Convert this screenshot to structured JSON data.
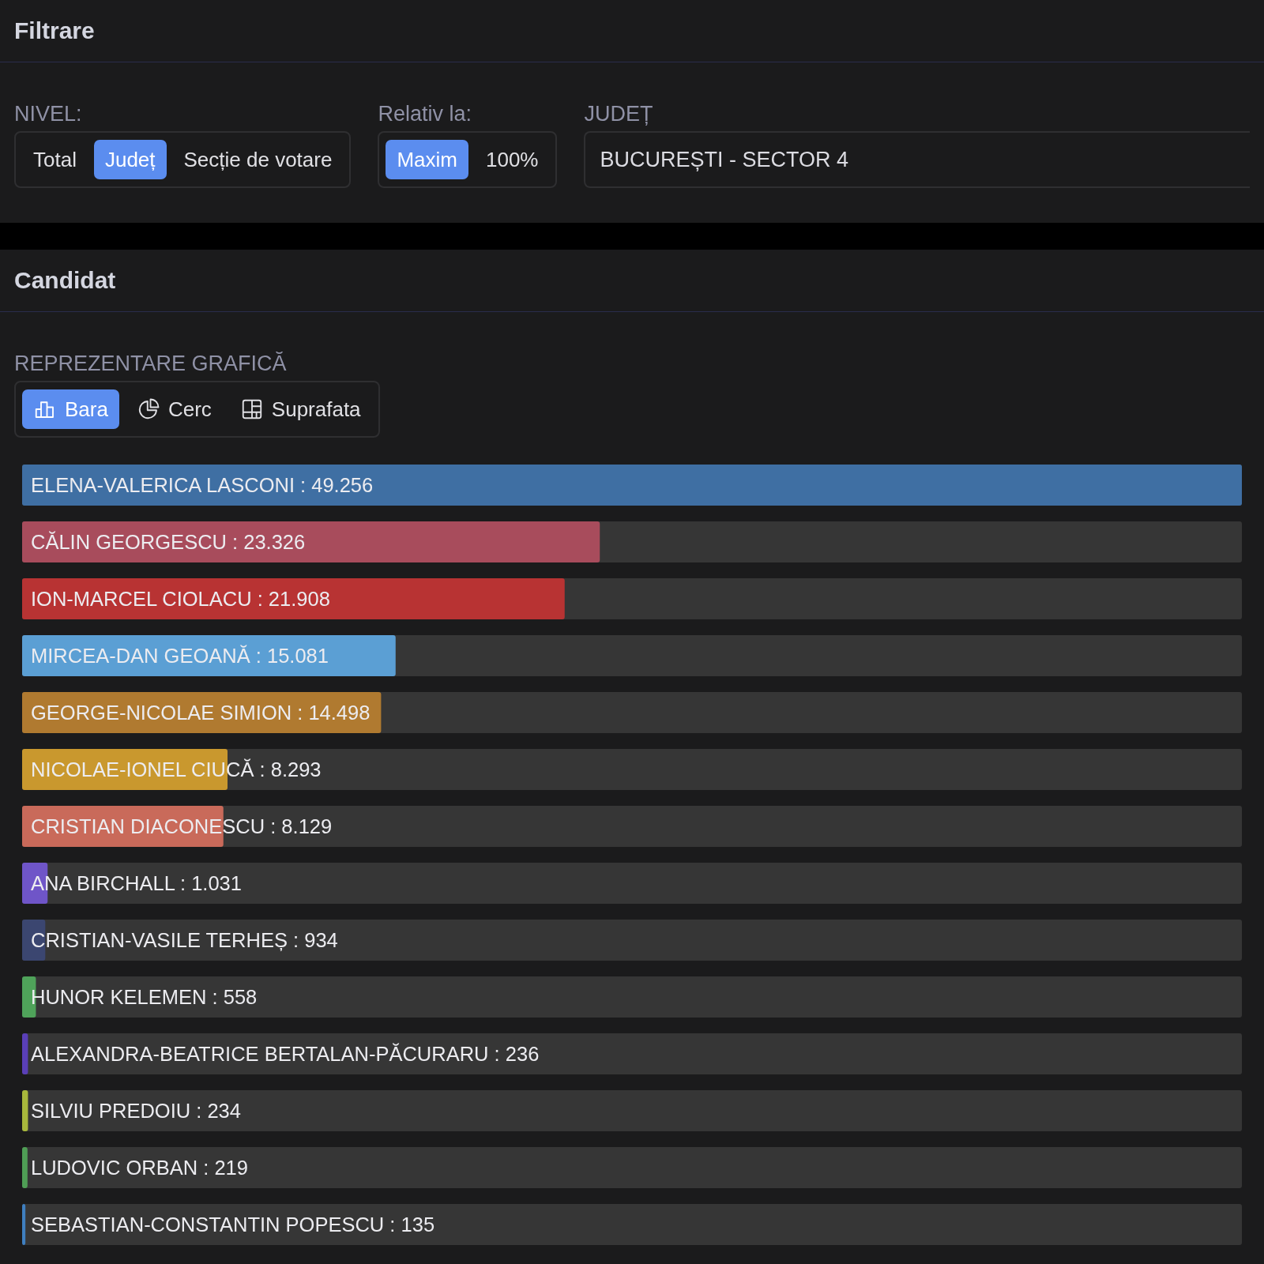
{
  "filtrare": {
    "title": "Filtrare",
    "nivel": {
      "label": "NIVEL:",
      "options": [
        {
          "label": "Total",
          "selected": false
        },
        {
          "label": "Județ",
          "selected": true
        },
        {
          "label": "Secție de votare",
          "selected": false
        }
      ]
    },
    "relativ": {
      "label": "Relativ la:",
      "options": [
        {
          "label": "Maxim",
          "selected": true
        },
        {
          "label": "100%",
          "selected": false
        }
      ]
    },
    "judet": {
      "label": "JUDEȚ",
      "value": "BUCUREȘTI - SECTOR 4"
    }
  },
  "candidat": {
    "title": "Candidat",
    "reprezentare": {
      "label": "REPREZENTARE GRAFICĂ",
      "options": [
        {
          "label": "Bara",
          "kind": "bar",
          "selected": true
        },
        {
          "label": "Cerc",
          "kind": "pie",
          "selected": false
        },
        {
          "label": "Suprafata",
          "kind": "grid",
          "selected": false
        }
      ]
    },
    "results": [
      {
        "label": "ELENA-VALERICA LASCONI : 49.256",
        "color": "#3f6fa3",
        "level": 1
      },
      {
        "label": "CĂLIN GEORGESCU : 23.326",
        "color": "#a84c5c",
        "level": 0.4736
      },
      {
        "label": "ION-MARCEL CIOLACU : 21.908",
        "color": "#b83333",
        "level": 0.4448
      },
      {
        "label": "MIRCEA-DAN GEOANĂ : 15.081",
        "color": "#5b9fd4",
        "level": 0.3062
      },
      {
        "label": "GEORGE-NICOLAE SIMION : 14.498",
        "color": "#b07a30",
        "level": 0.2943
      },
      {
        "label": "NICOLAE-IONEL CIUCĂ : 8.293",
        "color": "#c9982e",
        "level": 0.1684
      },
      {
        "label": "CRISTIAN DIACONESCU : 8.129",
        "color": "#c96a5a",
        "level": 0.165
      },
      {
        "label": "ANA BIRCHALL : 1.031",
        "color": "#6f55c8",
        "level": 0.0209
      },
      {
        "label": "CRISTIAN-VASILE TERHEȘ : 934",
        "color": "#3b4670",
        "level": 0.019
      },
      {
        "label": "HUNOR KELEMEN : 558",
        "color": "#4fa35a",
        "level": 0.0113
      },
      {
        "label": "ALEXANDRA-BEATRICE BERTALAN-PĂCURARU : 236",
        "color": "#5a3fb8",
        "level": 0.0048
      },
      {
        "label": "SILVIU PREDOIU : 234",
        "color": "#a8b83c",
        "level": 0.0048
      },
      {
        "label": "LUDOVIC ORBAN : 219",
        "color": "#4f9e55",
        "level": 0.0044
      },
      {
        "label": "SEBASTIAN-CONSTANTIN POPESCU : 135",
        "color": "#3f7fc0",
        "level": 0.0027
      }
    ]
  }
}
